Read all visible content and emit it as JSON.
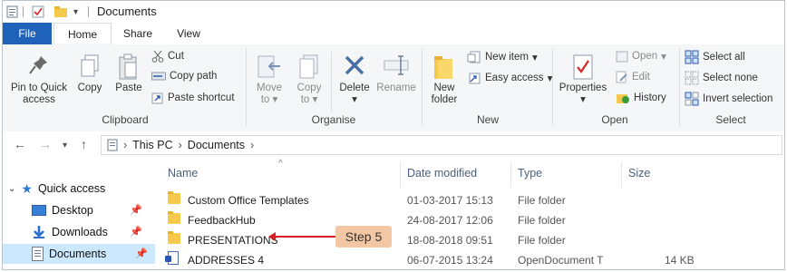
{
  "title": {
    "text": "Documents"
  },
  "tabs": {
    "file": "File",
    "home": "Home",
    "share": "Share",
    "view": "View"
  },
  "ribbon": {
    "clipboard": {
      "pin_line1": "Pin to Quick",
      "pin_line2": "access",
      "copy": "Copy",
      "paste": "Paste",
      "cut": "Cut",
      "copy_path": "Copy path",
      "paste_shortcut": "Paste shortcut",
      "label": "Clipboard"
    },
    "organise": {
      "move_line1": "Move",
      "move_line2": "to",
      "copy_line1": "Copy",
      "copy_line2": "to",
      "delete": "Delete",
      "rename": "Rename",
      "label": "Organise"
    },
    "new": {
      "folder_line1": "New",
      "folder_line2": "folder",
      "new_item": "New item",
      "easy_access": "Easy access",
      "label": "New"
    },
    "open": {
      "properties": "Properties",
      "open": "Open",
      "edit": "Edit",
      "history": "History",
      "label": "Open"
    },
    "select": {
      "select_all": "Select all",
      "select_none": "Select none",
      "invert": "Invert selection",
      "label": "Select"
    }
  },
  "address": {
    "crumbs": [
      "This PC",
      "Documents"
    ]
  },
  "nav": {
    "items": [
      {
        "label": "Quick access"
      },
      {
        "label": "Desktop"
      },
      {
        "label": "Downloads"
      },
      {
        "label": "Documents"
      }
    ]
  },
  "list": {
    "columns": [
      "Name",
      "Date modified",
      "Type",
      "Size"
    ],
    "rows": [
      {
        "name": "Custom Office Templates",
        "date": "01-03-2017 15:13",
        "type": "File folder",
        "size": ""
      },
      {
        "name": "FeedbackHub",
        "date": "24-08-2017 12:06",
        "type": "File folder",
        "size": ""
      },
      {
        "name": "PRESENTATIONS",
        "date": "18-08-2018 09:51",
        "type": "File folder",
        "size": ""
      },
      {
        "name": "ADDRESSES 4",
        "date": "06-07-2015 13:24",
        "type": "OpenDocument T",
        "size": "14 KB"
      }
    ]
  },
  "callout": {
    "text": "Step 5"
  },
  "colors": {
    "file_tab": "#1f62b9",
    "folder": "#f5c94c",
    "callout_bg": "#f3c7a4",
    "arrow": "#d61f26",
    "selected_nav": "#cce8ff"
  }
}
